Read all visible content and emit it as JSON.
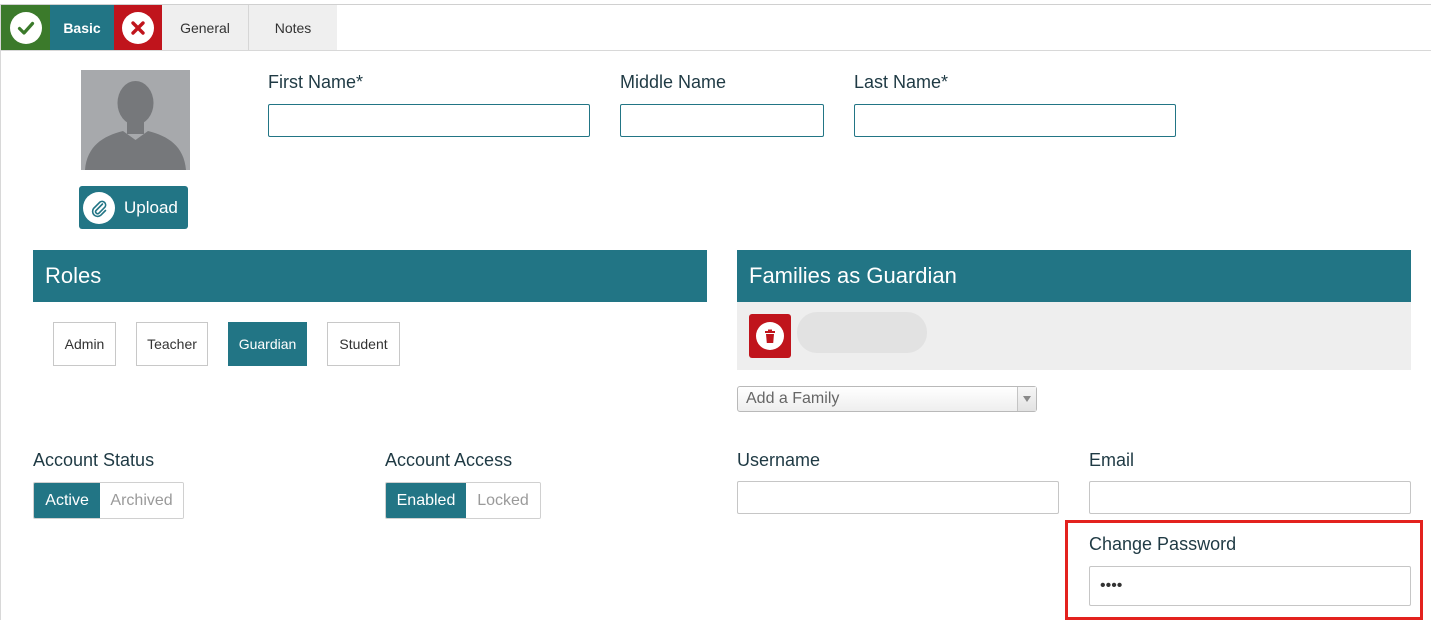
{
  "tabs": {
    "basic": "Basic",
    "general": "General",
    "notes": "Notes"
  },
  "photo": {
    "upload_label": "Upload"
  },
  "name": {
    "first_label": "First Name*",
    "middle_label": "Middle Name",
    "last_label": "Last Name*",
    "first_value": "",
    "middle_value": "",
    "last_value": ""
  },
  "roles": {
    "title": "Roles",
    "items": [
      {
        "label": "Admin",
        "active": false
      },
      {
        "label": "Teacher",
        "active": false
      },
      {
        "label": "Guardian",
        "active": true
      },
      {
        "label": "Student",
        "active": false
      }
    ]
  },
  "families": {
    "title": "Families as Guardian",
    "add_placeholder": "Add a Family"
  },
  "account_status": {
    "label": "Account Status",
    "options": [
      "Active",
      "Archived"
    ],
    "selected": "Active"
  },
  "account_access": {
    "label": "Account Access",
    "options": [
      "Enabled",
      "Locked"
    ],
    "selected": "Enabled"
  },
  "credentials": {
    "username_label": "Username",
    "email_label": "Email",
    "username_value": "",
    "email_value": "",
    "password_label": "Change Password",
    "password_value": "••••"
  },
  "colors": {
    "teal": "#227585",
    "ok_green": "#3b7a2b",
    "danger_red": "#c0141c",
    "highlight_red": "#e3221e"
  }
}
